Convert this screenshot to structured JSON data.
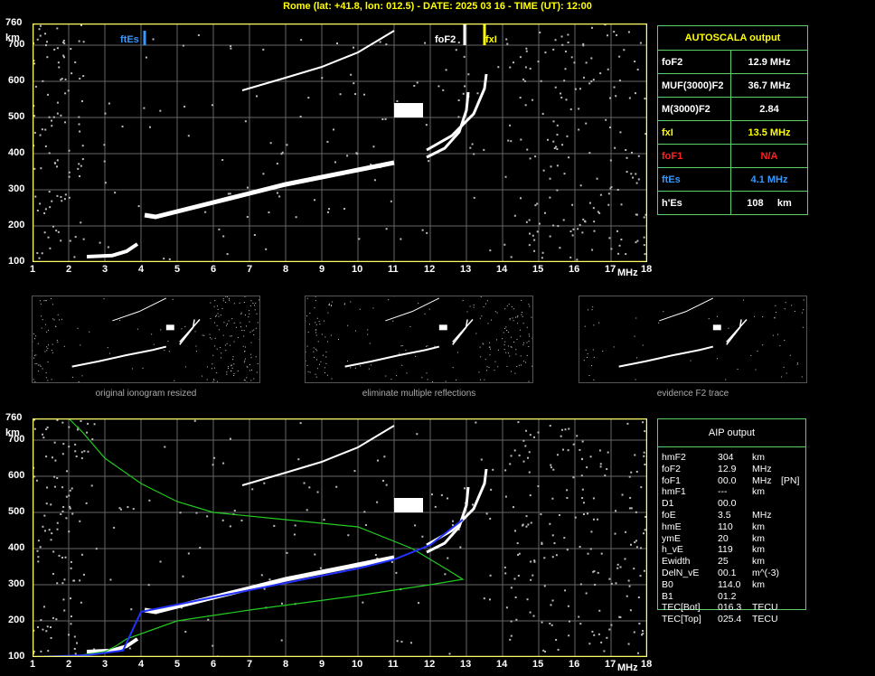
{
  "header": {
    "title": "Rome (lat: +41.8, lon: 012.5) - DATE: 2025 03 16 - TIME (UT): 12:00"
  },
  "axis": {
    "y_unit": "km",
    "x_unit": "MHz",
    "y_ticks": [
      "760",
      "700",
      "600",
      "500",
      "400",
      "300",
      "200",
      "100"
    ],
    "x_ticks": [
      "1",
      "2",
      "3",
      "4",
      "5",
      "6",
      "7",
      "8",
      "9",
      "10",
      "11",
      "12",
      "13",
      "14",
      "15",
      "16",
      "17",
      "18"
    ]
  },
  "markers": {
    "ftEs": "ftEs",
    "foF2": "foF2",
    "fxI": "fxI"
  },
  "thumbnails": [
    {
      "caption": "original ionogram resized"
    },
    {
      "caption": "eliminate multiple reflections"
    },
    {
      "caption": "evidence F2 trace"
    }
  ],
  "autoscala": {
    "title": "AUTOSCALA output",
    "rows": [
      {
        "key": "foF2",
        "value": "12.9 MHz",
        "color": "#ffffff"
      },
      {
        "key": "MUF(3000)F2",
        "value": "36.7 MHz",
        "color": "#ffffff"
      },
      {
        "key": "M(3000)F2",
        "value": "2.84",
        "color": "#ffffff"
      },
      {
        "key": "fxI",
        "value": "13.5 MHz",
        "color": "#ffff00"
      },
      {
        "key": "foF1",
        "value": "N/A",
        "color": "#ff2020"
      },
      {
        "key": "ftEs",
        "value": "4.1 MHz",
        "color": "#3399ff"
      },
      {
        "key": "h'Es",
        "value": "108     km",
        "color": "#ffffff"
      }
    ]
  },
  "aip": {
    "title": "AIP output",
    "rows": [
      {
        "k": "hmF2",
        "v": "304",
        "u": "km",
        "x": ""
      },
      {
        "k": "foF2",
        "v": "12.9",
        "u": "MHz",
        "x": ""
      },
      {
        "k": "foF1",
        "v": "00.0",
        "u": "MHz",
        "x": "[PN]"
      },
      {
        "k": "hmF1",
        "v": "---",
        "u": "km",
        "x": ""
      },
      {
        "k": "D1",
        "v": "00.0",
        "u": "",
        "x": ""
      },
      {
        "k": "foE",
        "v": "3.5",
        "u": "MHz",
        "x": ""
      },
      {
        "k": "hmE",
        "v": "110",
        "u": "km",
        "x": ""
      },
      {
        "k": "ymE",
        "v": "20",
        "u": "km",
        "x": ""
      },
      {
        "k": "h_vE",
        "v": "119",
        "u": "km",
        "x": ""
      },
      {
        "k": "Ewidth",
        "v": "25",
        "u": "km",
        "x": ""
      },
      {
        "k": "DelN_vE",
        "v": "00.1",
        "u": "m^(-3)",
        "x": ""
      },
      {
        "k": "B0",
        "v": "114.0",
        "u": "km",
        "x": ""
      },
      {
        "k": "B1",
        "v": "01.2",
        "u": "",
        "x": ""
      },
      {
        "k": "TEC[Bot]",
        "v": "016.3",
        "u": "TECU",
        "x": ""
      },
      {
        "k": "TEC[Top]",
        "v": "025.4",
        "u": "TECU",
        "x": ""
      }
    ]
  },
  "colors": {
    "axis": "#ffff66",
    "grid": "#666666",
    "trace": "#ffffff",
    "profile": "#22cc22",
    "fit": "#2233ff",
    "es": "#3399ff"
  }
}
